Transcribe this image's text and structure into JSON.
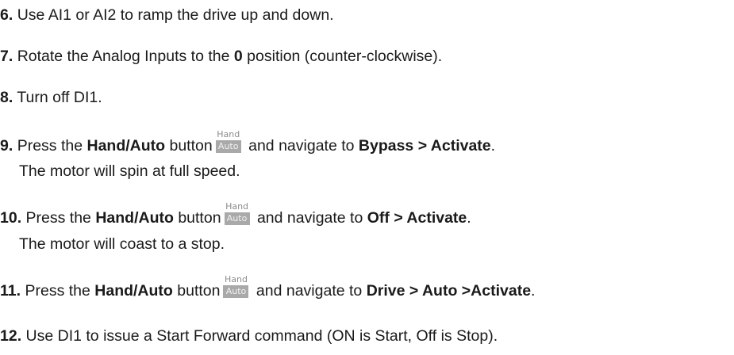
{
  "icon_button": {
    "name": "hand-auto-icon",
    "top_label": "Hand",
    "bottom_label": "Auto",
    "bg_color": "#a9a9a9"
  },
  "steps": [
    {
      "num": "6.",
      "text": "Use AI1 or AI2 to ramp the drive up and down."
    },
    {
      "num": "7.",
      "pre": "Rotate the Analog Inputs to the ",
      "bold": "0",
      "post": " position (counter-clockwise)."
    },
    {
      "num": "8.",
      "text": "Turn off DI1."
    },
    {
      "num": "9.",
      "pre": "Press the ",
      "button_label": "Hand/Auto",
      "mid": " button",
      "nav_pre": " and navigate to ",
      "nav_bold": "Bypass > Activate",
      "post": ".",
      "note": "The motor will spin at full speed."
    },
    {
      "num": "10.",
      "pre": "Press the ",
      "button_label": "Hand/Auto",
      "mid": " button",
      "nav_pre": " and navigate to ",
      "nav_bold": "Off > Activate",
      "post": ".",
      "note": "The motor will coast to a stop."
    },
    {
      "num": "11.",
      "pre": "Press the ",
      "button_label": "Hand/Auto",
      "mid": " button",
      "nav_pre": " and navigate to ",
      "nav_bold": "Drive > Auto >Activate",
      "post": "."
    },
    {
      "num": "12.",
      "text": "Use DI1 to issue a Start Forward command (ON is Start, Off is Stop)."
    }
  ]
}
